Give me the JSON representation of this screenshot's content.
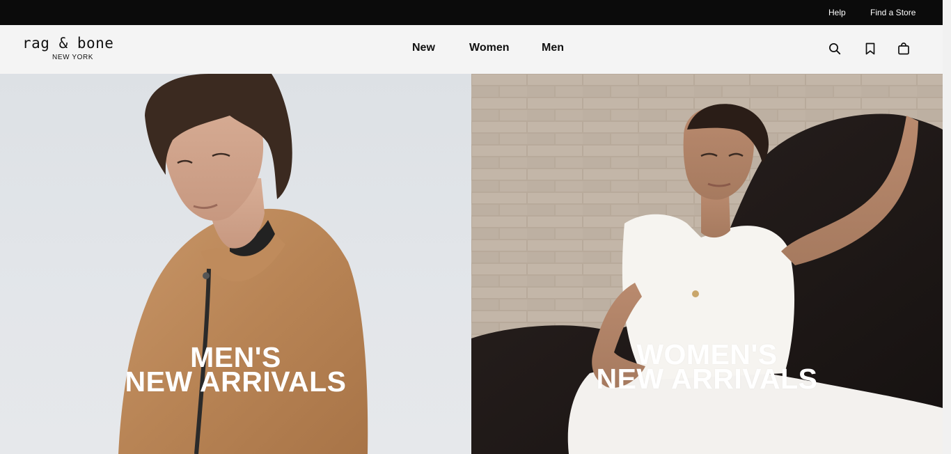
{
  "utility": {
    "help": "Help",
    "find_store": "Find a Store"
  },
  "header": {
    "logo_main": "rag & bone",
    "logo_sub": "NEW YORK",
    "nav": [
      {
        "label": "New"
      },
      {
        "label": "Women"
      },
      {
        "label": "Men"
      }
    ],
    "icons": [
      "search-icon",
      "bookmark-icon",
      "shopping-bag-icon"
    ]
  },
  "hero": {
    "men": {
      "line1": "MEN'S",
      "line2": "NEW ARRIVALS"
    },
    "women": {
      "line1": "WOMEN'S",
      "line2": "NEW ARRIVALS"
    }
  },
  "colors": {
    "utility_bg": "#0b0b0b",
    "header_bg": "#f4f4f4",
    "text": "#111111",
    "hero_text": "#ffffff"
  }
}
